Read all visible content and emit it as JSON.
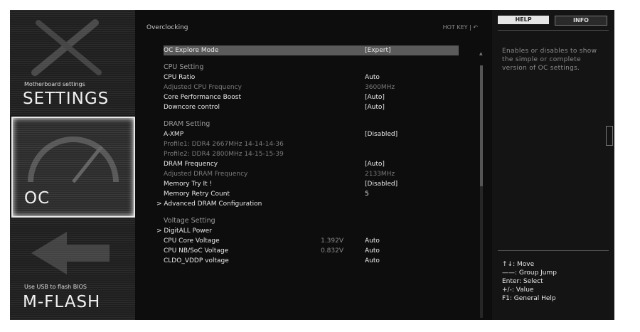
{
  "left_menu": {
    "settings": {
      "small": "Motherboard settings",
      "big": "SETTINGS"
    },
    "oc": {
      "big": "OC"
    },
    "mflash": {
      "small": "Use USB to flash BIOS",
      "big": "M-FLASH"
    }
  },
  "center": {
    "breadcrumb": "Overclocking",
    "hotkey": "HOT KEY  |  ↶",
    "rows": [
      {
        "label": "OC Explore Mode",
        "mid": "",
        "value": "[Expert]",
        "kind": "sel"
      },
      {
        "label": "CPU Setting",
        "mid": "",
        "value": "",
        "kind": "head"
      },
      {
        "label": "CPU Ratio",
        "mid": "",
        "value": "Auto",
        "kind": ""
      },
      {
        "label": "Adjusted CPU Frequency",
        "mid": "",
        "value": "3600MHz",
        "kind": "dim"
      },
      {
        "label": "Core Performance Boost",
        "mid": "",
        "value": "[Auto]",
        "kind": ""
      },
      {
        "label": "Downcore control",
        "mid": "",
        "value": "[Auto]",
        "kind": ""
      },
      {
        "label": "DRAM Setting",
        "mid": "",
        "value": "",
        "kind": "head"
      },
      {
        "label": "A-XMP",
        "mid": "",
        "value": "[Disabled]",
        "kind": ""
      },
      {
        "label": "Profile1: DDR4 2667MHz 14-14-14-36",
        "mid": "",
        "value": "",
        "kind": "dim"
      },
      {
        "label": "Profile2: DDR4 2800MHz 14-15-15-39",
        "mid": "",
        "value": "",
        "kind": "dim"
      },
      {
        "label": "DRAM Frequency",
        "mid": "",
        "value": "[Auto]",
        "kind": ""
      },
      {
        "label": "Adjusted DRAM Frequency",
        "mid": "",
        "value": "2133MHz",
        "kind": "dim"
      },
      {
        "label": "Memory Try It !",
        "mid": "",
        "value": "[Disabled]",
        "kind": ""
      },
      {
        "label": "Memory Retry Count",
        "mid": "",
        "value": "5",
        "kind": ""
      },
      {
        "label": "> Advanced DRAM Configuration",
        "mid": "",
        "value": "",
        "kind": "sub"
      },
      {
        "label": "Voltage Setting",
        "mid": "",
        "value": "",
        "kind": "head"
      },
      {
        "label": "> DigitALL Power",
        "mid": "",
        "value": "",
        "kind": "sub"
      },
      {
        "label": "CPU Core Voltage",
        "mid": "1.392V",
        "value": "Auto",
        "kind": ""
      },
      {
        "label": "CPU NB/SoC Voltage",
        "mid": "0.832V",
        "value": "Auto",
        "kind": ""
      },
      {
        "label": "CLDO_VDDP voltage",
        "mid": "",
        "value": "Auto",
        "kind": ""
      }
    ]
  },
  "right": {
    "tab_help": "HELP",
    "tab_info": "INFO",
    "help_text": "Enables or disables to show the simple or complete version of OC settings.",
    "keys": [
      "↑↓: Move",
      "——: Group Jump",
      "Enter: Select",
      "+/-: Value",
      "F1: General Help"
    ]
  }
}
